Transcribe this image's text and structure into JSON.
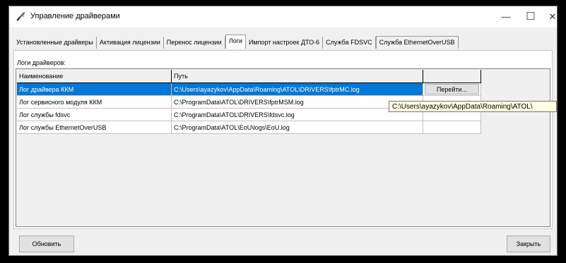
{
  "window": {
    "title": "Управление драйверами",
    "minimize_glyph": "—",
    "maximize_glyph": "☐",
    "close_glyph": "✕"
  },
  "tabs": [
    {
      "label": "Установленные драйверы"
    },
    {
      "label": "Активация лицензии"
    },
    {
      "label": "Перенос лицензии"
    },
    {
      "label": "Логи"
    },
    {
      "label": "Импорт настроек ДТО-6"
    },
    {
      "label": "Служба FDSVC"
    },
    {
      "label": "Служба EthernetOverUSB"
    }
  ],
  "active_tab_index": 3,
  "logs": {
    "section_label": "Логи драйверов:",
    "columns": [
      "Наименование",
      "Путь",
      ""
    ],
    "rows": [
      {
        "name": "Лог драйвера ККМ",
        "path": "C:\\Users\\ayazykov\\AppData\\Roaming\\ATOL\\DRIVERS\\fptrMC.log",
        "action": "Перейти..."
      },
      {
        "name": "Лог сервисного модуля ККМ",
        "path": "C:\\ProgramData\\ATOL\\DRIVERS\\fptrMSM.log",
        "action": ""
      },
      {
        "name": "Лог службы fdsvc",
        "path": "C:\\ProgramData\\ATOL\\DRIVERS\\fdsvc.log",
        "action": ""
      },
      {
        "name": "Лог службы EthernetOverUSB",
        "path": "C:\\ProgramData\\ATOL\\EoU\\logs\\EoU.log",
        "action": ""
      }
    ],
    "selected_row_index": 0,
    "tooltip": "C:\\Users\\ayazykov\\AppData\\Roaming\\ATOL\\"
  },
  "footer": {
    "refresh_label": "Обновить",
    "close_label": "Закрыть"
  },
  "colors": {
    "selection": "#0078d7",
    "tooltip_bg": "#ffffe1",
    "window_bg": "#f0f0f0"
  }
}
